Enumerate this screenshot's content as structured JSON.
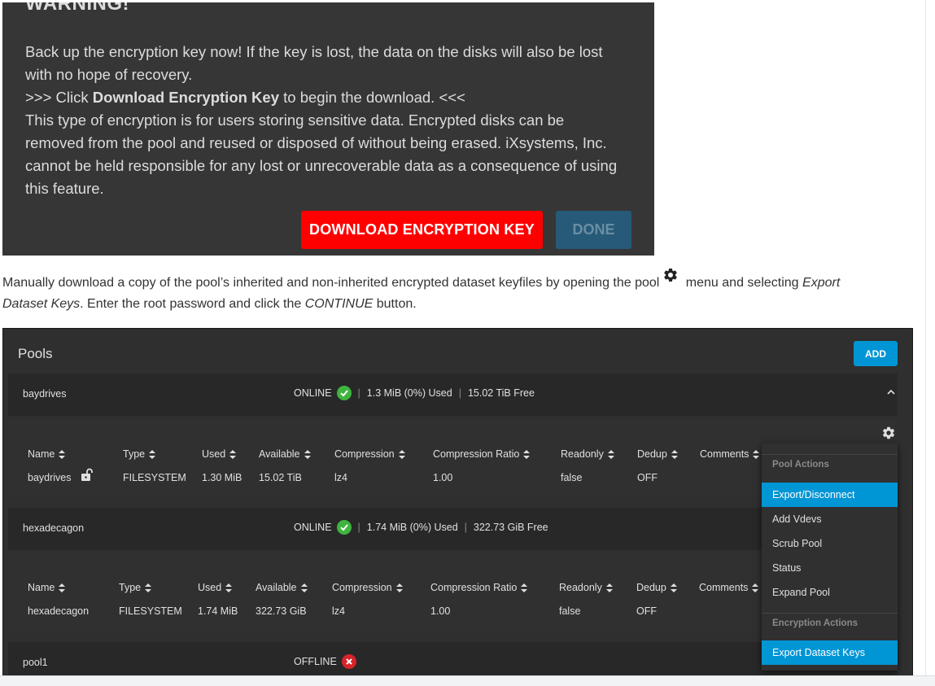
{
  "warning": {
    "title": "WARNING!",
    "line1": "Back up the encryption key now! If the key is lost, the data on the disks will also be lost",
    "line2": "with no hope of recovery.",
    "line3_prefix": ">>> Click ",
    "line3_bold": "Download Encryption Key",
    "line3_suffix": " to begin the download. <<<",
    "line4": "This type of encryption is for users storing sensitive data. Encrypted disks can be",
    "line5": "removed from the pool and reused or disposed of without being erased. iXsystems, Inc.",
    "line6": "cannot be held responsible for any lost or unrecoverable data as a consequence of using",
    "line7": "this feature.",
    "download_label": "DOWNLOAD ENCRYPTION KEY",
    "done_label": "DONE"
  },
  "paragraph": {
    "part1": "Manually download a copy of the pool’s inherited and non-inherited encrypted dataset keyfiles by opening the pool",
    "part2": " menu and selecting ",
    "italic1": "Export",
    "italic1b": "Dataset Keys",
    "part3": ". Enter the root password and click the ",
    "italic2": "CONTINUE",
    "part4": " button."
  },
  "pools": {
    "title": "Pools",
    "add_label": "ADD",
    "columns": [
      "Name",
      "Type",
      "Used",
      "Available",
      "Compression",
      "Compression Ratio",
      "Readonly",
      "Dedup",
      "Comments"
    ],
    "list": [
      {
        "name": "baydrives",
        "status": "ONLINE",
        "used": "1.3 MiB (0%) Used",
        "free": "15.02 TiB Free",
        "dataset": {
          "name": "baydrives",
          "type": "FILESYSTEM",
          "used": "1.30 MiB",
          "available": "15.02 TiB",
          "compression": "lz4",
          "ratio": "1.00",
          "readonly": "false",
          "dedup": "OFF"
        }
      },
      {
        "name": "hexadecagon",
        "status": "ONLINE",
        "used": "1.74 MiB (0%) Used",
        "free": "322.73 GiB Free",
        "dataset": {
          "name": "hexadecagon",
          "type": "FILESYSTEM",
          "used": "1.74 MiB",
          "available": "322.73 GiB",
          "compression": "lz4",
          "ratio": "1.00",
          "readonly": "false",
          "dedup": "OFF"
        }
      },
      {
        "name": "pool1",
        "status": "OFFLINE"
      }
    ],
    "sep": "|"
  },
  "menu": {
    "pool_actions_header": "Pool Actions",
    "items": [
      "Export/Disconnect",
      "Add Vdevs",
      "Scrub Pool",
      "Status",
      "Expand Pool"
    ],
    "encryption_actions_header": "Encryption Actions",
    "encryption_items": [
      "Export Dataset Keys"
    ]
  },
  "colors": {
    "accent": "#0095d5",
    "danger": "#ff0000",
    "online": "#3fb43f",
    "offline": "#d9232a"
  }
}
